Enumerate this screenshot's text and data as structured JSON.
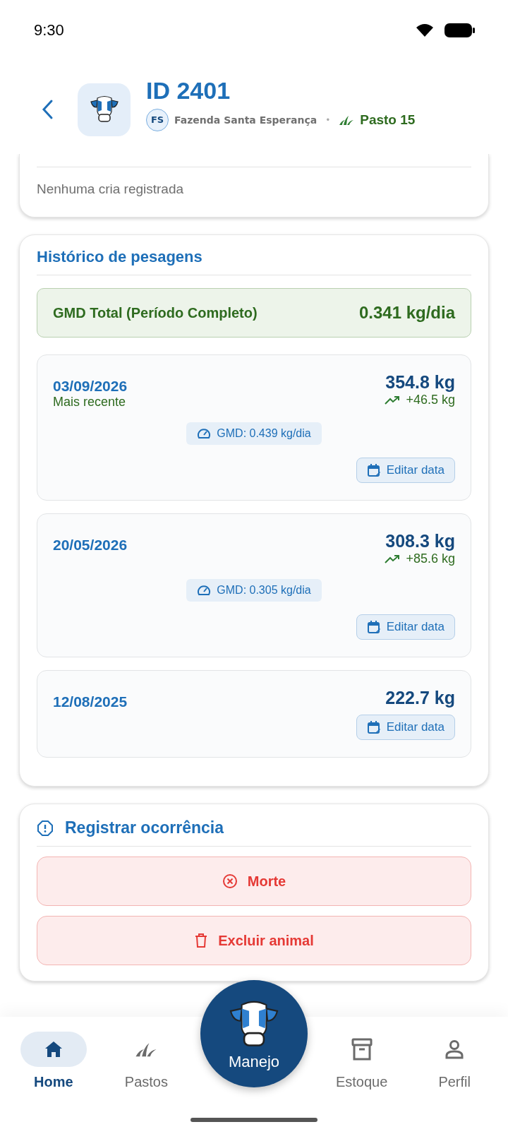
{
  "status_bar": {
    "time": "9:30"
  },
  "header": {
    "title": "ID 2401",
    "farm_initials": "FS",
    "farm": "Fazenda Santa Esperança",
    "separator": "•",
    "pasture": "Pasto 15"
  },
  "offspring_card": {
    "empty_text": "Nenhuma cria registrada"
  },
  "weighing_history": {
    "title": "Histórico de pesagens",
    "total_label": "GMD Total (Período Completo)",
    "total_value": "0.341 kg/dia",
    "entries": [
      {
        "date": "03/09/2026",
        "note": "Mais recente",
        "weight": "354.8 kg",
        "gain": "+46.5 kg",
        "gmd": "GMD: 0.439 kg/dia",
        "edit_label": "Editar data"
      },
      {
        "date": "20/05/2026",
        "weight": "308.3 kg",
        "gain": "+85.6 kg",
        "gmd": "GMD: 0.305 kg/dia",
        "edit_label": "Editar data"
      },
      {
        "date": "12/08/2025",
        "weight": "222.7 kg",
        "edit_label": "Editar data"
      }
    ]
  },
  "occurrence": {
    "title": "Registrar ocorrência",
    "actions": [
      {
        "kind": "death",
        "label": "Morte"
      },
      {
        "kind": "delete",
        "label": "Excluir animal"
      }
    ]
  },
  "bottom_nav": {
    "items": [
      {
        "kind": "home",
        "label": "Home",
        "selected": true
      },
      {
        "kind": "pastures",
        "label": "Pastos",
        "selected": false
      },
      {
        "kind": "fab",
        "label": "Manejo",
        "selected": false
      },
      {
        "kind": "stock",
        "label": "Estoque",
        "selected": false
      },
      {
        "kind": "profile",
        "label": "Perfil",
        "selected": false
      }
    ]
  }
}
